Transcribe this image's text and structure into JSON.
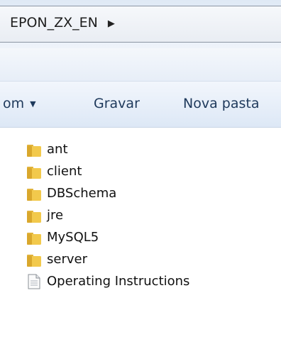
{
  "address_bar": {
    "path": "EPON_ZX_EN",
    "separator_icon": "chevron-right-icon"
  },
  "toolbar": {
    "share_label_partial": "om",
    "burn_label": "Gravar",
    "new_folder_label": "Nova pasta"
  },
  "files": [
    {
      "name": "ant",
      "type": "folder",
      "icon": "folder-icon"
    },
    {
      "name": "client",
      "type": "folder",
      "icon": "folder-icon"
    },
    {
      "name": "DBSchema",
      "type": "folder",
      "icon": "folder-icon"
    },
    {
      "name": "jre",
      "type": "folder",
      "icon": "folder-icon"
    },
    {
      "name": "MySQL5",
      "type": "folder",
      "icon": "folder-icon"
    },
    {
      "name": "server",
      "type": "folder",
      "icon": "folder-icon"
    },
    {
      "name": "Operating Instructions",
      "type": "file",
      "icon": "document-icon"
    }
  ],
  "colors": {
    "toolbar_text": "#1e395b",
    "folder_yellow": "#f2c94c",
    "file_text": "#111111"
  }
}
